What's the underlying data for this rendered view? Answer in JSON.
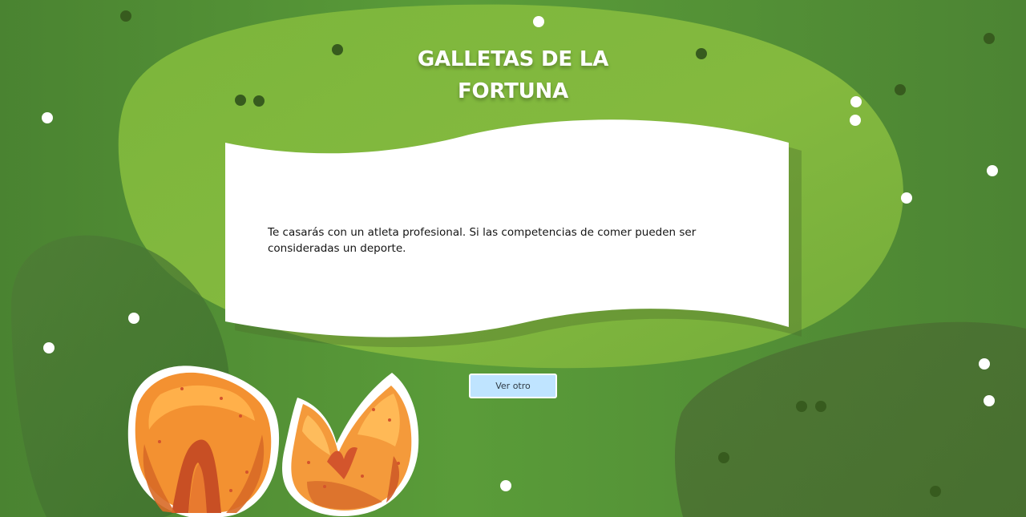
{
  "page": {
    "title_lines": [
      "GALLETAS DE LA",
      "FORTUNA"
    ],
    "fortune_message": "Te casarás con un atleta profesional. Si las competencias de comer pueden ser consideradas un deporte.",
    "next_button_label": "Ver otro"
  },
  "colors": {
    "background": "#4f8c34",
    "blob_light": "#86b93e",
    "blob_dark": "#3f6f2e",
    "paper": "#ffffff",
    "button": "#bfe4ff",
    "cookie_orange": "#f49a3b"
  }
}
